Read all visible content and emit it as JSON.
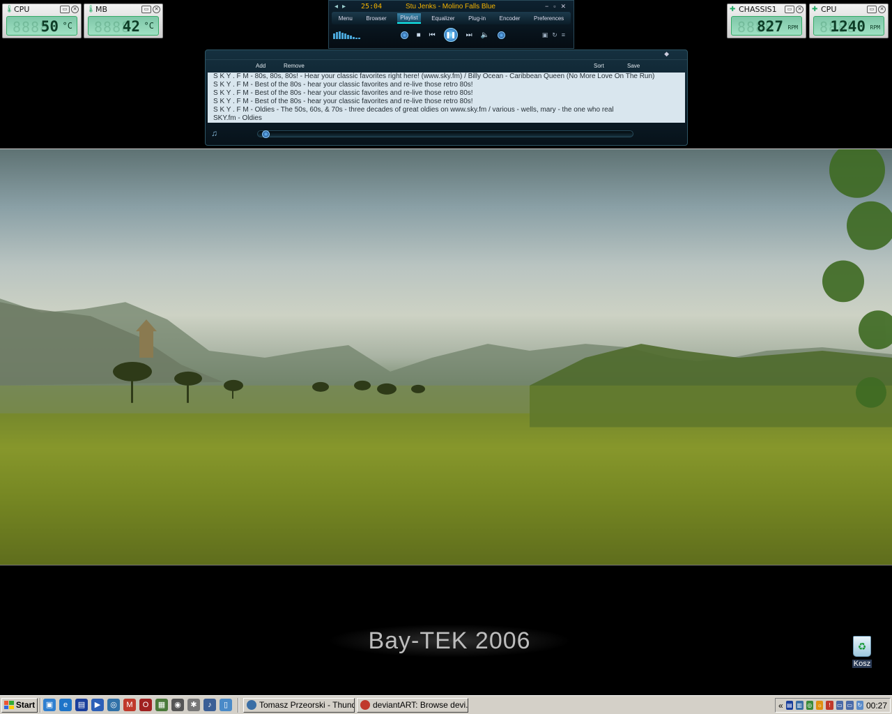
{
  "sensors": [
    {
      "id": "cpu-temp",
      "label": "CPU",
      "value": "50",
      "unit": "°C",
      "icon": "thermometer-icon"
    },
    {
      "id": "mb-temp",
      "label": "MB",
      "value": "42",
      "unit": "°C",
      "icon": "thermometer-icon"
    },
    {
      "id": "chassis-fan",
      "label": "CHASSIS1",
      "value": "827",
      "unit": "RPM",
      "icon": "fan-icon"
    },
    {
      "id": "cpu-fan",
      "label": "CPU",
      "value": "1240",
      "unit": "RPM",
      "icon": "fan-icon"
    }
  ],
  "player": {
    "time": "25:04",
    "track": "Stu Jenks - Molino Falls Blue",
    "menu": [
      "Menu",
      "Browser",
      "Playlist",
      "Equalizer",
      "Plug-in",
      "Encoder",
      "Preferences"
    ],
    "active_menu": "Playlist"
  },
  "playlist": {
    "tools": {
      "add": "Add",
      "remove": "Remove",
      "sort": "Sort",
      "save": "Save"
    },
    "items": [
      "S K Y . F M - 80s, 80s, 80s! - Hear your classic favorites right here! (www.sky.fm) / Billy Ocean - Caribbean Queen (No More Love On The Run)",
      "S K Y . F M - Best of the 80s - hear your classic favorites and re-live those retro 80s!",
      "S K Y . F M - Best of the 80s - hear your classic favorites and re-live those retro 80s!",
      "S K Y . F M - Best of the 80s - hear your classic favorites and re-live those retro 80s!",
      "S K Y . F M - Oldies - The 50s, 60s, & 70s - three decades of great oldies on www.sky.fm / various - wells, mary - the one who real",
      "SKY.fm - Oldies"
    ]
  },
  "desktop": {
    "brand": "Bay-TEK 2006",
    "recycle_label": "Kosz"
  },
  "taskbar": {
    "start": "Start",
    "tasks": [
      {
        "label": "Tomasz Przeorski - Thund...",
        "color": "#3a6ea5"
      },
      {
        "label": "deviantART: Browse devi...",
        "color": "#c0392b"
      }
    ],
    "clock": "00:27",
    "tray_arrow": "«"
  },
  "colors": {
    "accent": "#f5b400",
    "lcd": "#9fe0c3",
    "taskbar": "#d4d0c8"
  }
}
